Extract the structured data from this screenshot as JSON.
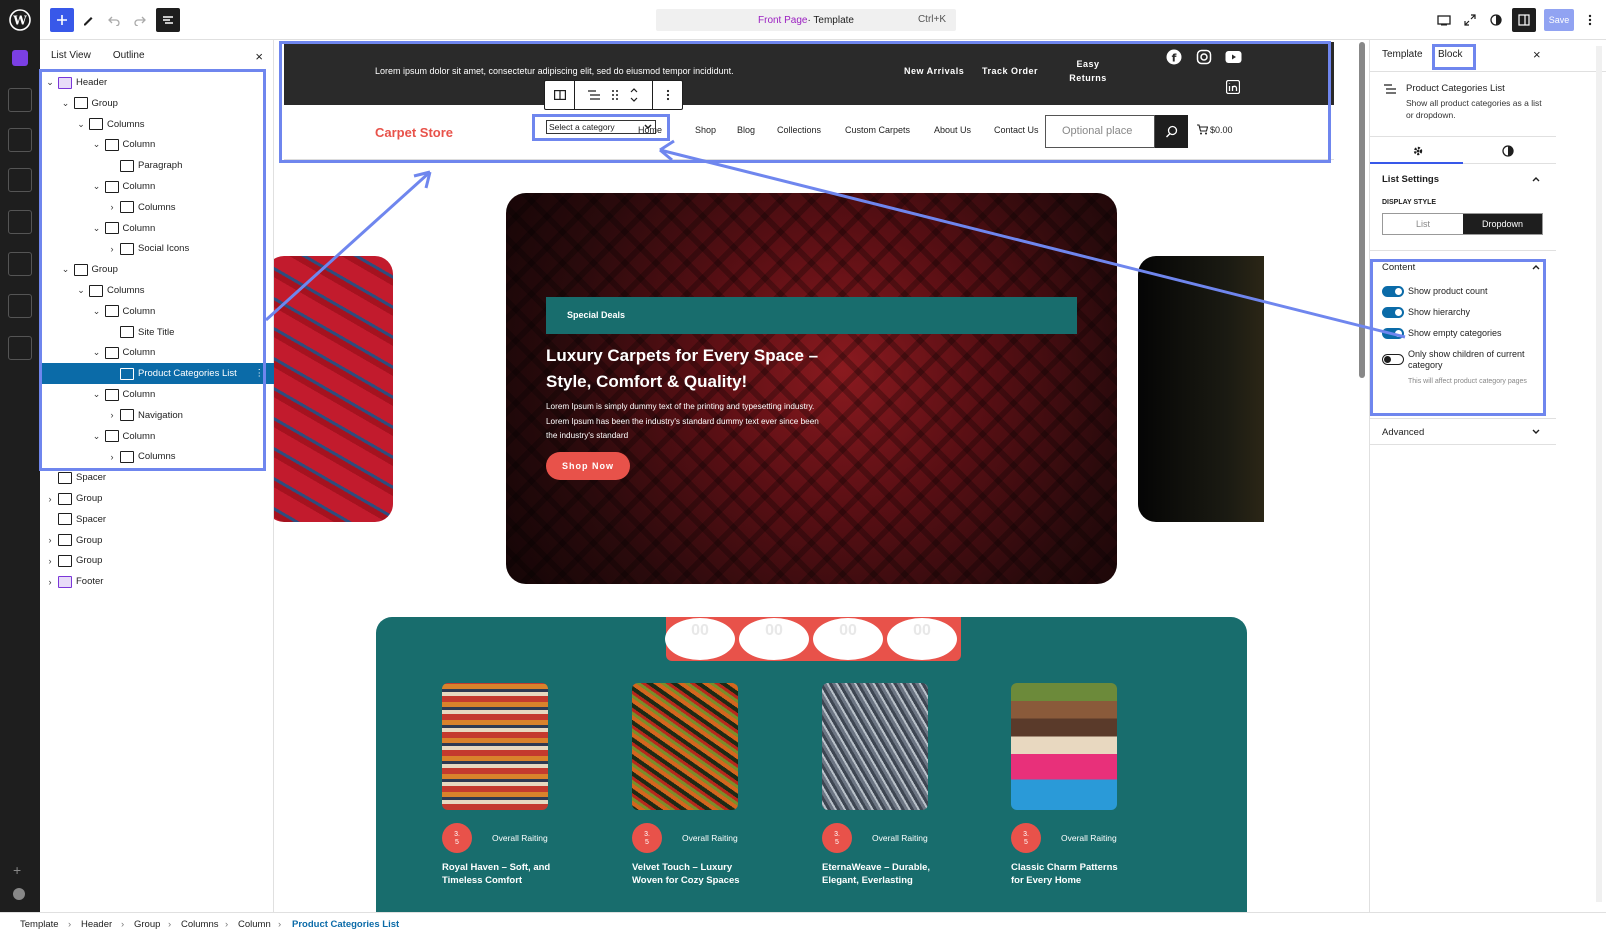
{
  "topbar": {
    "template_name": "Front Page",
    "template_suffix": " · Template",
    "shortcut": "Ctrl+K",
    "save_label": "Save"
  },
  "listview": {
    "tab_list": "List View",
    "tab_outline": "Outline",
    "close": "×",
    "items": [
      {
        "label": "Header",
        "depth": 0,
        "icon": "template-part-icon"
      },
      {
        "label": "Group",
        "depth": 1,
        "icon": "group-icon"
      },
      {
        "label": "Columns",
        "depth": 2,
        "icon": "columns-icon"
      },
      {
        "label": "Column",
        "depth": 3,
        "icon": "column-icon"
      },
      {
        "label": "Paragraph",
        "depth": 4,
        "icon": "paragraph-icon"
      },
      {
        "label": "Column",
        "depth": 3,
        "icon": "column-icon"
      },
      {
        "label": "Columns",
        "depth": 4,
        "icon": "columns-icon"
      },
      {
        "label": "Column",
        "depth": 3,
        "icon": "column-icon"
      },
      {
        "label": "Social Icons",
        "depth": 4,
        "icon": "share-icon"
      },
      {
        "label": "Group",
        "depth": 1,
        "icon": "group-icon"
      },
      {
        "label": "Columns",
        "depth": 2,
        "icon": "columns-icon"
      },
      {
        "label": "Column",
        "depth": 3,
        "icon": "column-icon"
      },
      {
        "label": "Site Title",
        "depth": 4,
        "icon": "map-pin-icon"
      },
      {
        "label": "Column",
        "depth": 3,
        "icon": "column-icon"
      },
      {
        "label": "Product Categories List",
        "depth": 4,
        "icon": "list-icon",
        "selected": true
      },
      {
        "label": "Column",
        "depth": 3,
        "icon": "column-icon"
      },
      {
        "label": "Navigation",
        "depth": 4,
        "icon": "compass-icon"
      },
      {
        "label": "Column",
        "depth": 3,
        "icon": "column-icon"
      },
      {
        "label": "Columns",
        "depth": 4,
        "icon": "columns-icon"
      },
      {
        "label": "Spacer",
        "depth": 0,
        "icon": "spacer-icon"
      },
      {
        "label": "Group",
        "depth": 0,
        "icon": "group-icon"
      },
      {
        "label": "Spacer",
        "depth": 0,
        "icon": "spacer-icon"
      },
      {
        "label": "Group",
        "depth": 0,
        "icon": "group-icon"
      },
      {
        "label": "Group",
        "depth": 0,
        "icon": "group-icon"
      },
      {
        "label": "Footer",
        "depth": 0,
        "icon": "template-part-icon"
      }
    ]
  },
  "site": {
    "top_text": "Lorem ipsum dolor sit amet, consectetur adipiscing elit, sed do eiusmod tempor incididunt.",
    "top_links": [
      "New Arrivals",
      "Track Order",
      "Easy\nReturns"
    ],
    "site_title": "Carpet Store",
    "category_select": "Select a category",
    "nav": [
      "Home",
      "Shop",
      "Blog",
      "Collections",
      "Custom Carpets",
      "About Us",
      "Contact Us"
    ],
    "search_placeholder": "Optional place",
    "cart_total": "$0.00"
  },
  "hero": {
    "badge": "Special Deals",
    "title": "Luxury Carpets for Every Space – Style, Comfort & Quality!",
    "text": "Lorem Ipsum is simply dummy text of the printing and typesetting industry. Lorem Ipsum has been the industry's standard dummy text ever since been the industry's standard",
    "cta": "Shop Now"
  },
  "countdown": [
    "00",
    "00",
    "00",
    "00"
  ],
  "products": [
    {
      "name": "Royal Haven – Soft, and Timeless Comfort",
      "rating": "3.\n5",
      "rating_label": "Overall Raiting"
    },
    {
      "name": "Velvet Touch – Luxury Woven for Cozy Spaces",
      "rating": "3.\n5",
      "rating_label": "Overall Raiting"
    },
    {
      "name": "EternaWeave – Durable, Elegant, Everlasting",
      "rating": "3.\n5",
      "rating_label": "Overall Raiting"
    },
    {
      "name": "Classic Charm Patterns for Every Home",
      "rating": "3.\n5",
      "rating_label": "Overall Raiting"
    }
  ],
  "sidebar": {
    "tab_template": "Template",
    "tab_block": "Block",
    "close": "×",
    "block_title": "Product Categories List",
    "block_desc": "Show all product categories as a list or dropdown.",
    "list_settings": "List Settings",
    "display_style_label": "DISPLAY STYLE",
    "display_options": [
      "List",
      "Dropdown"
    ],
    "display_selected": "Dropdown",
    "content_heading": "Content",
    "toggles": [
      {
        "label": "Show product count",
        "on": true
      },
      {
        "label": "Show hierarchy",
        "on": true
      },
      {
        "label": "Show empty categories",
        "on": true
      },
      {
        "label": "Only show children of current category",
        "on": false
      }
    ],
    "toggle_help": "This will affect product category pages",
    "advanced": "Advanced"
  },
  "breadcrumb": [
    "Template",
    "Header",
    "Group",
    "Columns",
    "Column",
    "Product Categories List"
  ],
  "colors": {
    "accent": "#3858e9",
    "selection": "#0b6ba8",
    "highlight": "#6f86ee",
    "teal": "#186d6d",
    "coral": "#e8524a",
    "site_title": "#e8524a"
  }
}
